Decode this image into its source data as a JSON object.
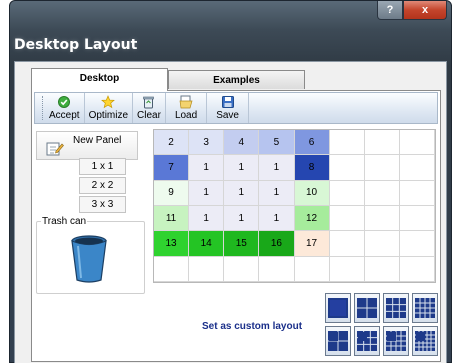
{
  "window": {
    "title": "Desktop Layout",
    "help_label": "?",
    "close_label": "x"
  },
  "tabs": [
    {
      "label": "Desktop",
      "active": true
    },
    {
      "label": "Examples",
      "active": false
    }
  ],
  "toolbar": {
    "accept_label": "Accept",
    "optimize_label": "Optimize",
    "clear_label": "Clear",
    "load_label": "Load",
    "save_label": "Save"
  },
  "new_panel": {
    "label": "New Panel",
    "sizes": [
      "1 x 1",
      "2 x 2",
      "3 x 3"
    ]
  },
  "trash": {
    "label": "Trash can"
  },
  "grid": {
    "rows": [
      [
        {
          "t": "2",
          "c": "#dde3f6"
        },
        {
          "t": "3",
          "c": "#dde3f6"
        },
        {
          "t": "4",
          "c": "#c3cdf0"
        },
        {
          "t": "5",
          "c": "#b6c4ef"
        },
        {
          "t": "6",
          "c": "#7f97e0"
        },
        {
          "t": "",
          "c": ""
        },
        {
          "t": "",
          "c": ""
        },
        {
          "t": "",
          "c": ""
        }
      ],
      [
        {
          "t": "7",
          "c": "#5a78d6"
        },
        {
          "t": "1",
          "c": "#ececf6"
        },
        {
          "t": "1",
          "c": "#ececf6"
        },
        {
          "t": "1",
          "c": "#ececf6"
        },
        {
          "t": "8",
          "c": "#2546b0"
        },
        {
          "t": "",
          "c": ""
        },
        {
          "t": "",
          "c": ""
        },
        {
          "t": "",
          "c": ""
        }
      ],
      [
        {
          "t": "9",
          "c": "#eefbee"
        },
        {
          "t": "1",
          "c": "#ececf6"
        },
        {
          "t": "1",
          "c": "#ececf6"
        },
        {
          "t": "1",
          "c": "#ececf6"
        },
        {
          "t": "10",
          "c": "#d8f7d5"
        },
        {
          "t": "",
          "c": ""
        },
        {
          "t": "",
          "c": ""
        },
        {
          "t": "",
          "c": ""
        }
      ],
      [
        {
          "t": "11",
          "c": "#c7f3c0"
        },
        {
          "t": "1",
          "c": "#ececf6"
        },
        {
          "t": "1",
          "c": "#ececf6"
        },
        {
          "t": "1",
          "c": "#ececf6"
        },
        {
          "t": "12",
          "c": "#a6ec9c"
        },
        {
          "t": "",
          "c": ""
        },
        {
          "t": "",
          "c": ""
        },
        {
          "t": "",
          "c": ""
        }
      ],
      [
        {
          "t": "13",
          "c": "#2fd22f"
        },
        {
          "t": "14",
          "c": "#24c424"
        },
        {
          "t": "15",
          "c": "#1fb81f"
        },
        {
          "t": "16",
          "c": "#19a819"
        },
        {
          "t": "17",
          "c": "#fde9d9"
        },
        {
          "t": "",
          "c": ""
        },
        {
          "t": "",
          "c": ""
        },
        {
          "t": "",
          "c": ""
        }
      ],
      [
        {
          "t": "",
          "c": ""
        },
        {
          "t": "",
          "c": ""
        },
        {
          "t": "",
          "c": ""
        },
        {
          "t": "",
          "c": ""
        },
        {
          "t": "",
          "c": ""
        },
        {
          "t": "",
          "c": ""
        },
        {
          "t": "",
          "c": ""
        },
        {
          "t": "",
          "c": ""
        }
      ]
    ]
  },
  "custom_layout_label": "Set as custom layout",
  "layout_presets": [
    {
      "n": 1
    },
    {
      "n": 2
    },
    {
      "n": 3
    },
    {
      "n": 4
    },
    {
      "n": 5
    },
    {
      "n": 6
    },
    {
      "n": 7
    },
    {
      "n": 8
    }
  ]
}
